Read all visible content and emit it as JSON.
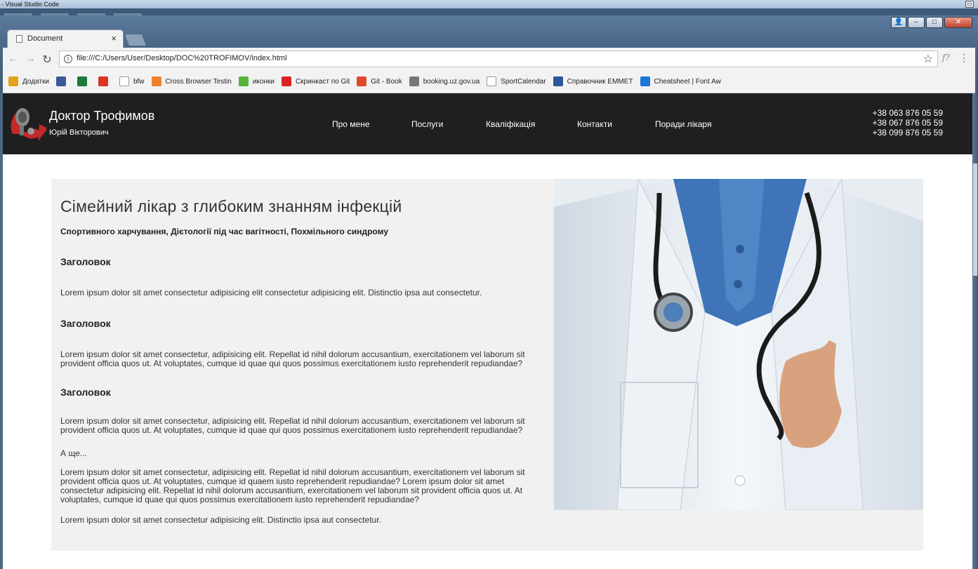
{
  "os": {
    "title": "- Visual Studio Code",
    "minimize_glyph": "▭"
  },
  "browser": {
    "tab_title": "Document",
    "tab_close": "×",
    "url": "file:///C:/Users/User/Desktop/DOC%20TROFIMOV/index.html",
    "back": "←",
    "forward": "→",
    "reload": "↻",
    "star": "☆",
    "ext": "f?",
    "menu": "⋮",
    "window_controls": {
      "minimize": "–",
      "maximize": "□",
      "close": "✕",
      "user": "👤"
    },
    "bookmarks": [
      {
        "label": "Додатки",
        "icon": "apps-icon",
        "color": "#e3a21a"
      },
      {
        "label": "",
        "icon": "facebook-icon",
        "color": "#3b5998"
      },
      {
        "label": "",
        "icon": "bet365-icon",
        "color": "#1d7a3a"
      },
      {
        "label": "",
        "icon": "ukrnet-icon",
        "color": "#d32"
      },
      {
        "label": "bfw",
        "icon": "bfw-icon",
        "color": "#ffffff"
      },
      {
        "label": "Cross Browser Testin",
        "icon": "crossbrowser-icon",
        "color": "#f1812a"
      },
      {
        "label": "иконки",
        "icon": "icons8-icon",
        "color": "#59b33a"
      },
      {
        "label": "Скринкаст по Git",
        "icon": "screencast-icon",
        "color": "#d22"
      },
      {
        "label": "Git - Book",
        "icon": "git-icon",
        "color": "#e0482b"
      },
      {
        "label": "booking.uz.gov.ua",
        "icon": "uz-icon",
        "color": "#777"
      },
      {
        "label": "SportCalendar",
        "icon": "page-icon",
        "color": "#ffffff"
      },
      {
        "label": "Справочник EMMET",
        "icon": "word-icon",
        "color": "#2b579a"
      },
      {
        "label": "Cheatsheet | Font Aw",
        "icon": "flag-icon",
        "color": "#1d75d8"
      }
    ]
  },
  "site": {
    "brand_name": "Доктор Трофимов",
    "brand_sub": "Юрій Вікторович",
    "nav": [
      "Про мене",
      "Послуги",
      "Кваліфікація",
      "Контакти",
      "Поради лікаря"
    ],
    "phones": [
      "+38 063 876 05 59",
      "+38 067 876 05 59",
      "+38 099 876 05 59"
    ],
    "colors": {
      "header_bg": "#1f1f1f",
      "card_bg": "#f1f1f1",
      "logo_red": "#c62828"
    }
  },
  "main": {
    "title": "Сімейний лікар з глибоким знанням інфекцій",
    "subtitle": "Спортивного харчування, Дієтології під час вагітності, Похмільного синдрому",
    "sections": [
      {
        "heading": "Заголовок",
        "text": "Lorem ipsum dolor sit amet consectetur adipisicing elit consectetur adipisicing elit. Distinctio ipsa aut consectetur."
      },
      {
        "heading": "Заголовок",
        "text": "Lorem ipsum dolor sit amet consectetur, adipisicing elit. Repellat id nihil dolorum accusantium, exercitationem vel laborum sit provident officia quos ut. At voluptates, cumque id quae qui quos possimus exercitationem iusto reprehenderit repudiandae?"
      },
      {
        "heading": "Заголовок",
        "text": "Lorem ipsum dolor sit amet consectetur, adipisicing elit. Repellat id nihil dolorum accusantium, exercitationem vel laborum sit provident officia quos ut. At voluptates, cumque id quae qui quos possimus exercitationem iusto reprehenderit repudiandae?"
      }
    ],
    "more_label": "А ще...",
    "long_para": "Lorem ipsum dolor sit amet consectetur, adipisicing elit. Repellat id nihil dolorum accusantium, exercitationem vel laborum sit provident officia quos ut. At voluptates, cumque id quaem iusto reprehenderit repudiandae? Lorem ipsum dolor sit amet consectetur adipisicing elit. Repellat id nihil dolorum accusantium, exercitationem vel laborum sit provident officia quos ut. At voluptates, cumque id quae qui quos possimus exercitationem iusto reprehenderit repudiandae?",
    "last_para": "Lorem ipsum dolor sit amet consectetur adipisicing elit. Distinctio ipsa aut consectetur."
  }
}
